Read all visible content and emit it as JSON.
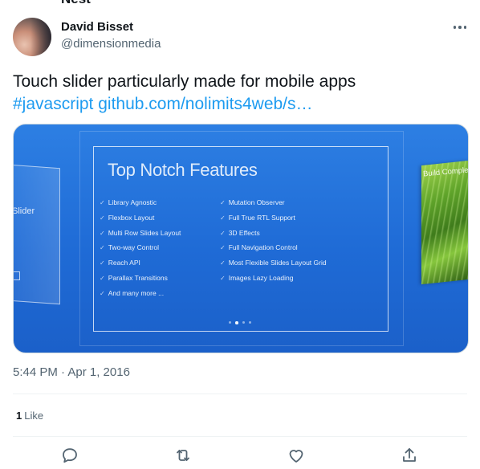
{
  "author": {
    "name": "David Bisset",
    "handle": "@dimensionmedia"
  },
  "tweet": {
    "text": "Touch slider particularly made for mobile apps",
    "hashtag": "#javascript",
    "link": "github.com/nolimits4web/s…",
    "timestamp": "5:44 PM · Apr 1, 2016"
  },
  "media": {
    "slide_title": "Top Notch Features",
    "left_label": "Slider",
    "right_label": "Build Comple",
    "features_left": [
      "Library Agnostic",
      "Flexbox Layout",
      "Multi Row Slides Layout",
      "Two-way Control",
      "Reach API",
      "Parallax Transitions",
      "And many more ..."
    ],
    "features_right": [
      "Mutation Observer",
      "Full True RTL Support",
      "3D Effects",
      "Full Navigation Control",
      "Most Flexible Slides Layout Grid",
      "Images Lazy Loading"
    ],
    "pagination_active_index": 1,
    "pagination_count": 4
  },
  "engagement": {
    "like_count": "1",
    "like_label": "Like"
  },
  "actions": [
    "reply-icon",
    "retweet-icon",
    "like-icon",
    "share-icon"
  ],
  "colors": {
    "link": "#1d9bf0",
    "secondary_text": "#536471",
    "media_blue": "#1f6bd6"
  }
}
